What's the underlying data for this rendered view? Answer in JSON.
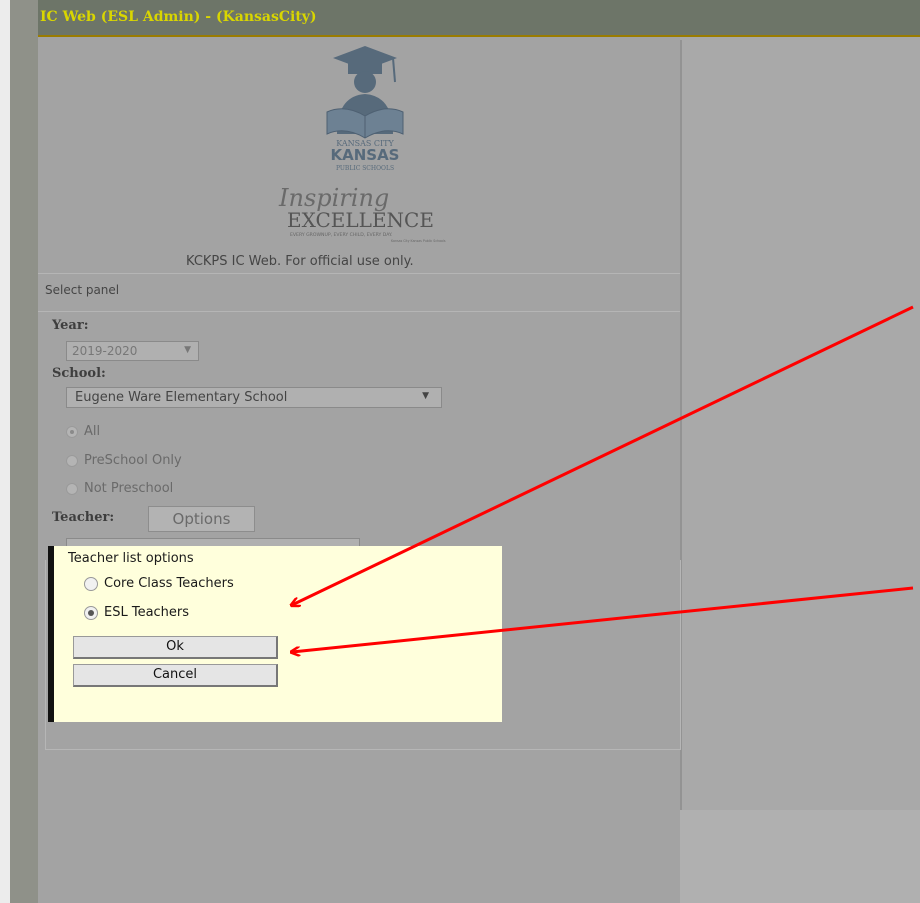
{
  "window": {
    "title": "IC Web (ESL Admin) -  (KansasCity)"
  },
  "logo": {
    "line1": "KANSAS CITY",
    "line2": "KANSAS",
    "line3": "PUBLIC SCHOOLS",
    "tagline_script": "Inspiring",
    "tagline_main": "EXCELLENCE",
    "tagline_sub": "EVERY GROWNUP, EVERY CHILD, EVERY DAY.",
    "tagline_small": "Kansas City Kansas Public Schools"
  },
  "notice": "KCKPS IC Web. For official use only.",
  "panel": {
    "header": "Select panel",
    "year_label": "Year:",
    "year_value": "2019-2020",
    "school_label": "School:",
    "school_value": "Eugene Ware Elementary School",
    "filters": [
      {
        "label": "All",
        "checked": true
      },
      {
        "label": "PreSchool Only",
        "checked": false
      },
      {
        "label": "Not Preschool",
        "checked": false
      }
    ],
    "teacher_label": "Teacher:",
    "options_button": "Options"
  },
  "popup": {
    "title": "Teacher list options",
    "options": [
      {
        "label": "Core Class Teachers",
        "checked": false
      },
      {
        "label": "ESL Teachers",
        "checked": true
      }
    ],
    "ok_label": "Ok",
    "cancel_label": "Cancel"
  },
  "colors": {
    "title_text": "#d9d600",
    "popup_bg": "#ffffdc",
    "annotation_arrow": "#ff0000"
  }
}
